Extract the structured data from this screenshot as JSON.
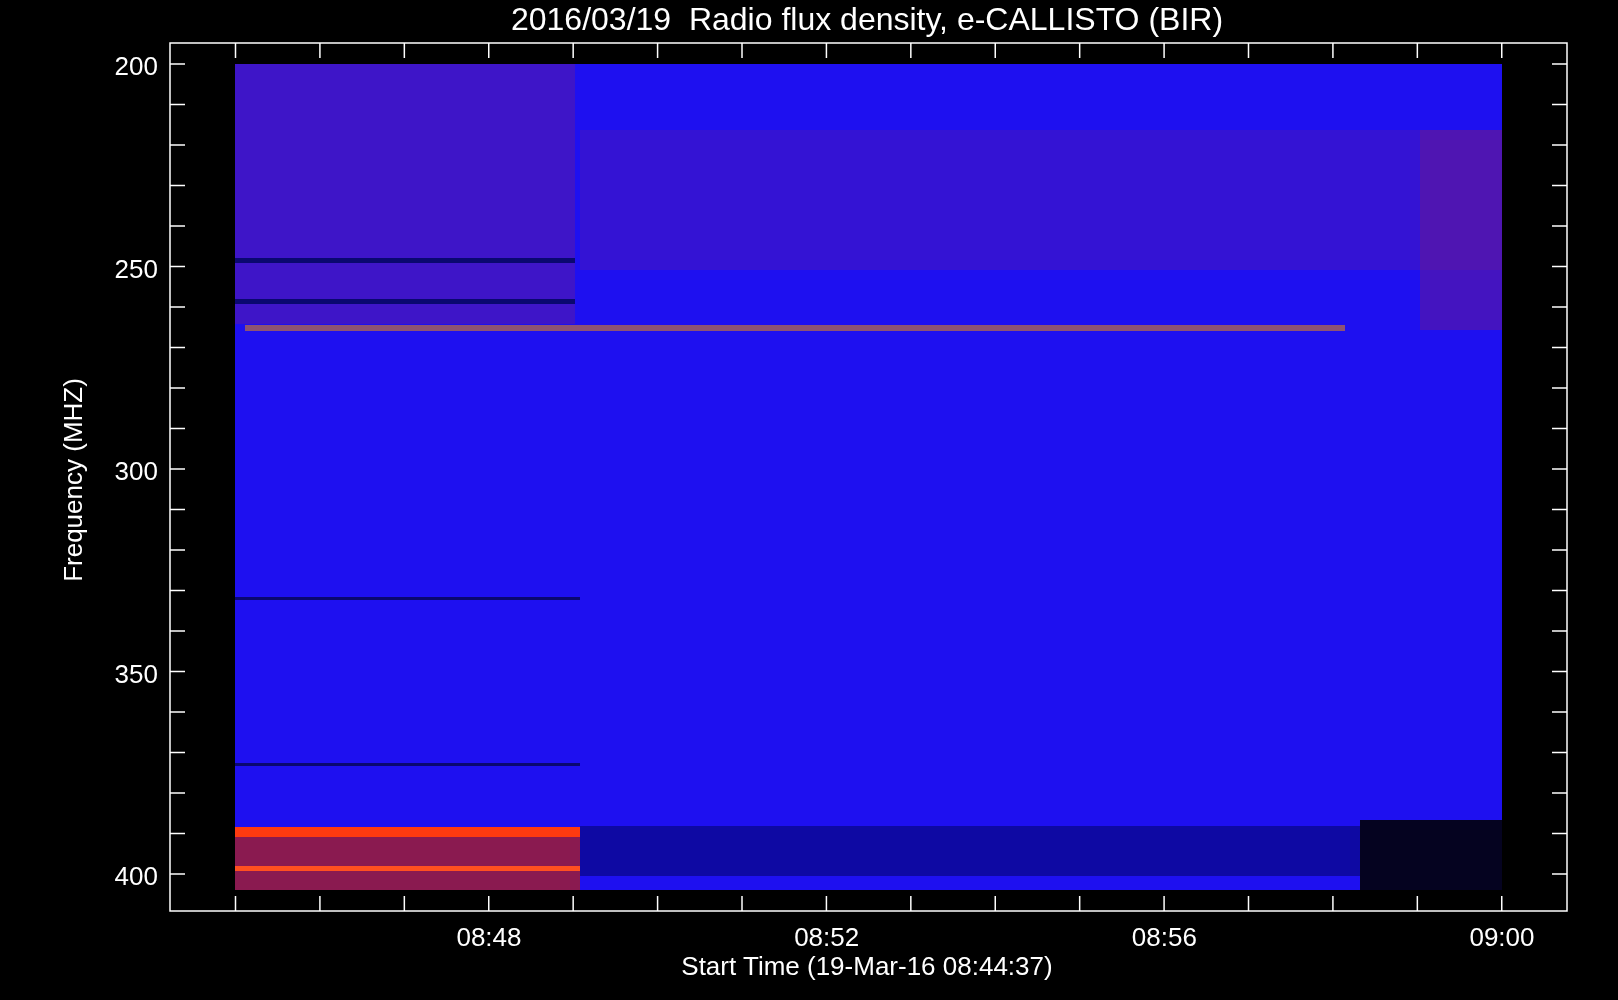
{
  "title": "2016/03/19  Radio flux density, e-CALLISTO (BIR)",
  "y_axis": {
    "label": "Frequency (MHZ)",
    "ticks": [
      "200",
      "250",
      "300",
      "350",
      "400"
    ]
  },
  "x_axis": {
    "label": "Start Time (19-Mar-16 08:44:37)",
    "ticks": [
      "08:48",
      "08:52",
      "08:56",
      "09:00"
    ]
  }
}
